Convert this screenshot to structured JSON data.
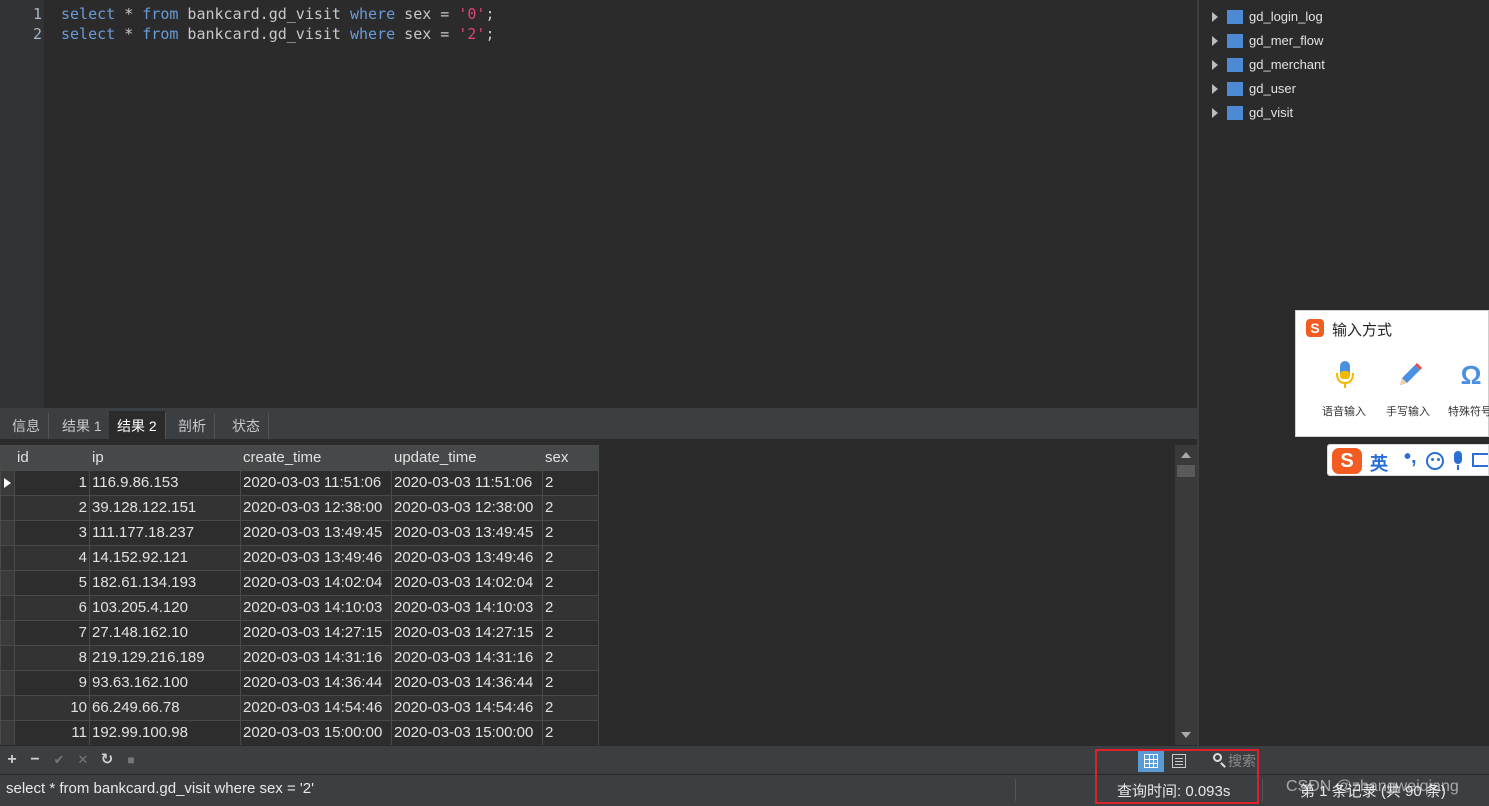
{
  "editor": {
    "lines": [
      {
        "number": "1",
        "kw1": "select",
        "mid1": " * ",
        "kw2": "from",
        "mid2": " bankcard.gd_visit ",
        "kw3": "where",
        "mid3": " sex = ",
        "str": "'0'",
        "end": ";"
      },
      {
        "number": "2",
        "kw1": "select",
        "mid1": " * ",
        "kw2": "from",
        "mid2": " bankcard.gd_visit ",
        "kw3": "where",
        "mid3": " sex = ",
        "str": "'2'",
        "end": ";"
      }
    ]
  },
  "tabs": [
    {
      "label": "信息",
      "active": false
    },
    {
      "label": "结果 1",
      "active": false
    },
    {
      "label": "结果 2",
      "active": true
    },
    {
      "label": "剖析",
      "active": false
    },
    {
      "label": "状态",
      "active": false
    }
  ],
  "grid": {
    "columns": [
      "id",
      "ip",
      "create_time",
      "update_time",
      "sex"
    ],
    "rows": [
      [
        "1",
        "116.9.86.153",
        "2020-03-03 11:51:06",
        "2020-03-03 11:51:06",
        "2"
      ],
      [
        "2",
        "39.128.122.151",
        "2020-03-03 12:38:00",
        "2020-03-03 12:38:00",
        "2"
      ],
      [
        "3",
        "111.177.18.237",
        "2020-03-03 13:49:45",
        "2020-03-03 13:49:45",
        "2"
      ],
      [
        "4",
        "14.152.92.121",
        "2020-03-03 13:49:46",
        "2020-03-03 13:49:46",
        "2"
      ],
      [
        "5",
        "182.61.134.193",
        "2020-03-03 14:02:04",
        "2020-03-03 14:02:04",
        "2"
      ],
      [
        "6",
        "103.205.4.120",
        "2020-03-03 14:10:03",
        "2020-03-03 14:10:03",
        "2"
      ],
      [
        "7",
        "27.148.162.10",
        "2020-03-03 14:27:15",
        "2020-03-03 14:27:15",
        "2"
      ],
      [
        "8",
        "219.129.216.189",
        "2020-03-03 14:31:16",
        "2020-03-03 14:31:16",
        "2"
      ],
      [
        "9",
        "93.63.162.100",
        "2020-03-03 14:36:44",
        "2020-03-03 14:36:44",
        "2"
      ],
      [
        "10",
        "66.249.66.78",
        "2020-03-03 14:54:46",
        "2020-03-03 14:54:46",
        "2"
      ],
      [
        "11",
        "192.99.100.98",
        "2020-03-03 15:00:00",
        "2020-03-03 15:00:00",
        "2"
      ]
    ]
  },
  "toolbar": {
    "add": "+",
    "remove": "−",
    "apply": "✔",
    "discard": "✕",
    "refresh": "↻",
    "stop": "■",
    "search_placeholder": "搜索"
  },
  "status": {
    "sql": "select * from bankcard.gd_visit where sex = '2'",
    "query_time": "查询时间: 0.093s",
    "records": "第 1 条记录 (共 90 条)",
    "watermark": "CSDN @zhangweiqiang"
  },
  "sidebar": {
    "tables": [
      "gd_login_log",
      "gd_mer_flow",
      "gd_merchant",
      "gd_user",
      "gd_visit"
    ]
  },
  "ime": {
    "logo": "S",
    "title": "输入方式",
    "options": [
      "语音输入",
      "手写输入",
      "特殊符号"
    ],
    "bar_mode": "英",
    "bar_punct": "•,"
  },
  "colors": {
    "keyword": "#6a9bd8",
    "string": "#e0457b",
    "highlight_border": "#e0202a",
    "ime_brand": "#f25c22"
  }
}
